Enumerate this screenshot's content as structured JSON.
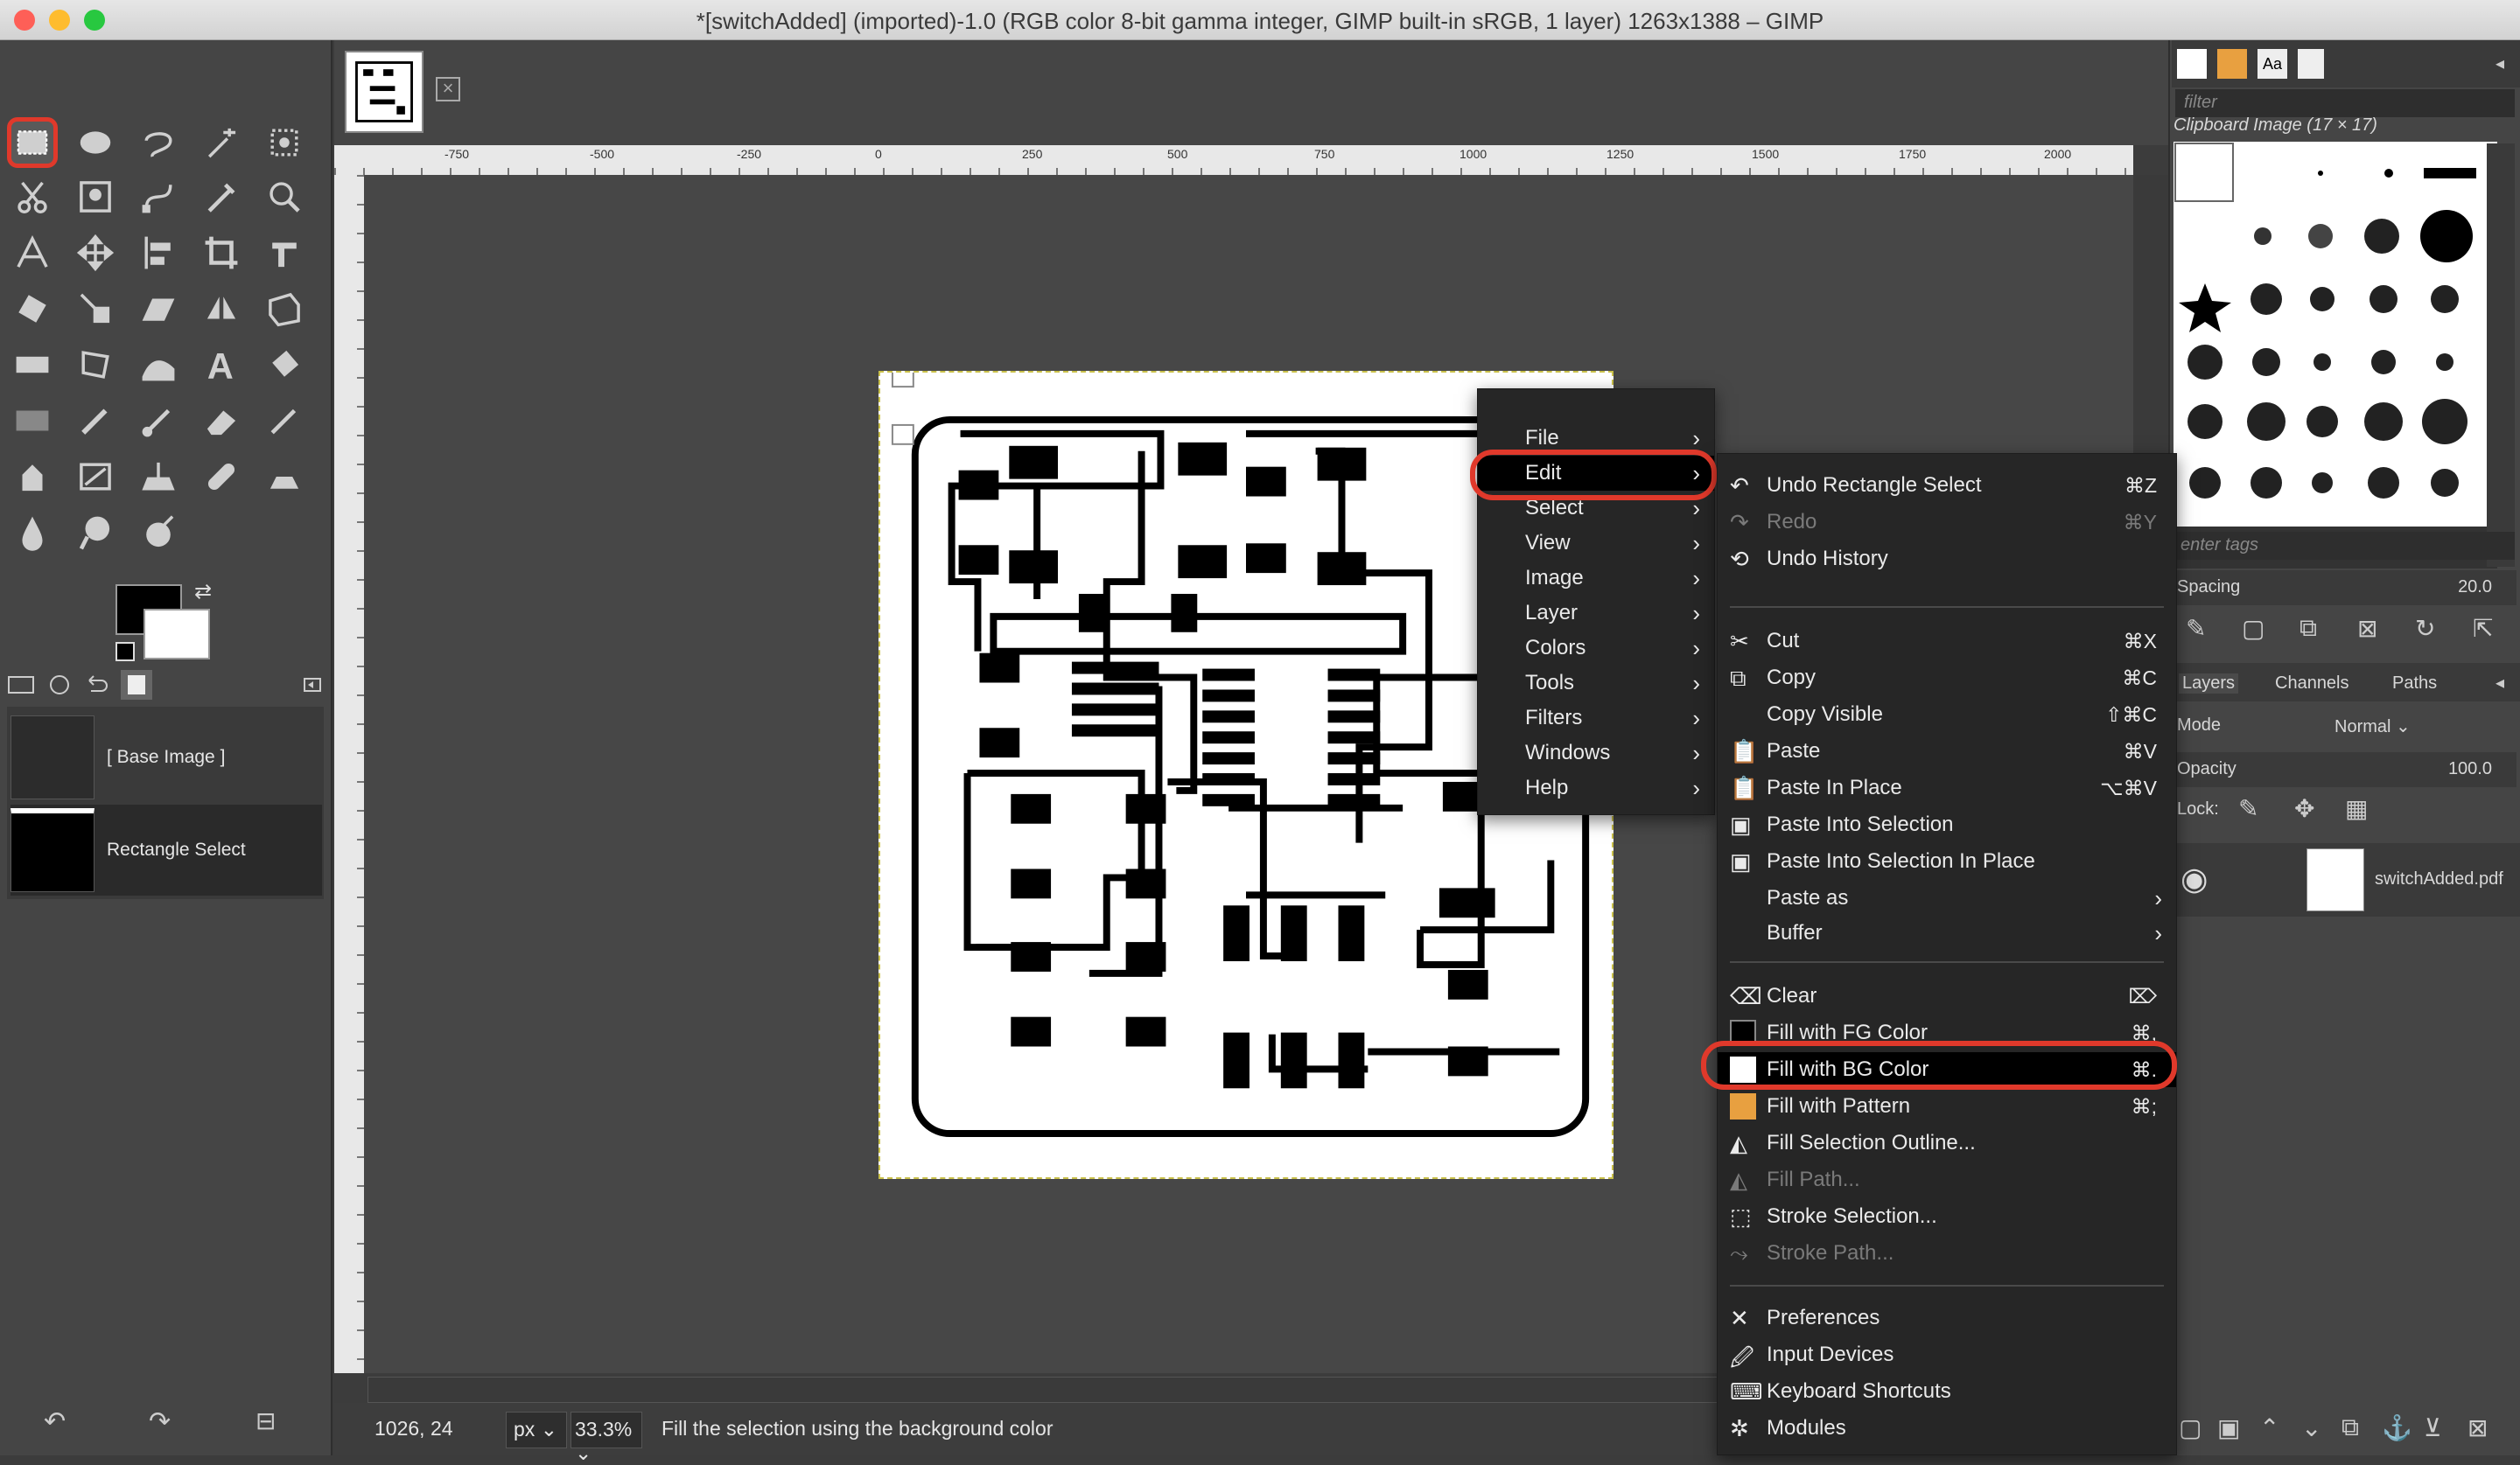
{
  "window": {
    "title": "*[switchAdded] (imported)-1.0 (RGB color 8-bit gamma integer, GIMP built-in sRGB, 1 layer) 1263x1388 – GIMP"
  },
  "toolbox": {
    "history": [
      {
        "label": "[ Base Image ]"
      },
      {
        "label": "Rectangle Select"
      }
    ]
  },
  "ruler": {
    "ticks": [
      "-750",
      "-500",
      "-250",
      "0",
      "250",
      "500",
      "750",
      "1000",
      "1250",
      "1500",
      "1750",
      "2000"
    ]
  },
  "statusbar": {
    "coords": "1026, 24",
    "unit": "px",
    "zoom": "33.3%",
    "message": "Fill the selection using the background color"
  },
  "context_menu": {
    "items": [
      "File",
      "Edit",
      "Select",
      "View",
      "Image",
      "Layer",
      "Colors",
      "Tools",
      "Filters",
      "Windows",
      "Help"
    ],
    "active": "Edit"
  },
  "edit_menu": {
    "items": [
      {
        "label": "Undo Rectangle Select",
        "shortcut": "⌘Z"
      },
      {
        "label": "Redo",
        "shortcut": "⌘Y"
      },
      {
        "label": "Undo History",
        "shortcut": ""
      },
      {
        "label": "Cut",
        "shortcut": "⌘X"
      },
      {
        "label": "Copy",
        "shortcut": "⌘C"
      },
      {
        "label": "Copy Visible",
        "shortcut": "⇧⌘C"
      },
      {
        "label": "Paste",
        "shortcut": "⌘V"
      },
      {
        "label": "Paste In Place",
        "shortcut": "⌥⌘V"
      },
      {
        "label": "Paste Into Selection",
        "shortcut": ""
      },
      {
        "label": "Paste Into Selection In Place",
        "shortcut": ""
      },
      {
        "label": "Paste as",
        "shortcut": ""
      },
      {
        "label": "Buffer",
        "shortcut": ""
      },
      {
        "label": "Clear",
        "shortcut": "⌦"
      },
      {
        "label": "Fill with FG Color",
        "shortcut": "⌘,"
      },
      {
        "label": "Fill with BG Color",
        "shortcut": "⌘."
      },
      {
        "label": "Fill with Pattern",
        "shortcut": "⌘;"
      },
      {
        "label": "Fill Selection Outline...",
        "shortcut": ""
      },
      {
        "label": "Fill Path...",
        "shortcut": ""
      },
      {
        "label": "Stroke Selection...",
        "shortcut": ""
      },
      {
        "label": "Stroke Path...",
        "shortcut": ""
      },
      {
        "label": "Preferences",
        "shortcut": ""
      },
      {
        "label": "Input Devices",
        "shortcut": ""
      },
      {
        "label": "Keyboard Shortcuts",
        "shortcut": ""
      },
      {
        "label": "Modules",
        "shortcut": ""
      }
    ]
  },
  "brushes": {
    "filter_placeholder": "filter",
    "current": "Clipboard Image (17 × 17)",
    "tags_placeholder": "enter tags",
    "spacing_label": "Spacing",
    "spacing_value": "20.0"
  },
  "layers": {
    "tabs": [
      "Layers",
      "Channels",
      "Paths"
    ],
    "mode_label": "Mode",
    "mode_value": "Normal",
    "opacity_label": "Opacity",
    "opacity_value": "100.0",
    "lock_label": "Lock:",
    "layer_name": "switchAdded.pdf"
  },
  "colors": {
    "accent": "#e0392b",
    "menu_bg": "#262626",
    "panel_bg": "#454545"
  }
}
